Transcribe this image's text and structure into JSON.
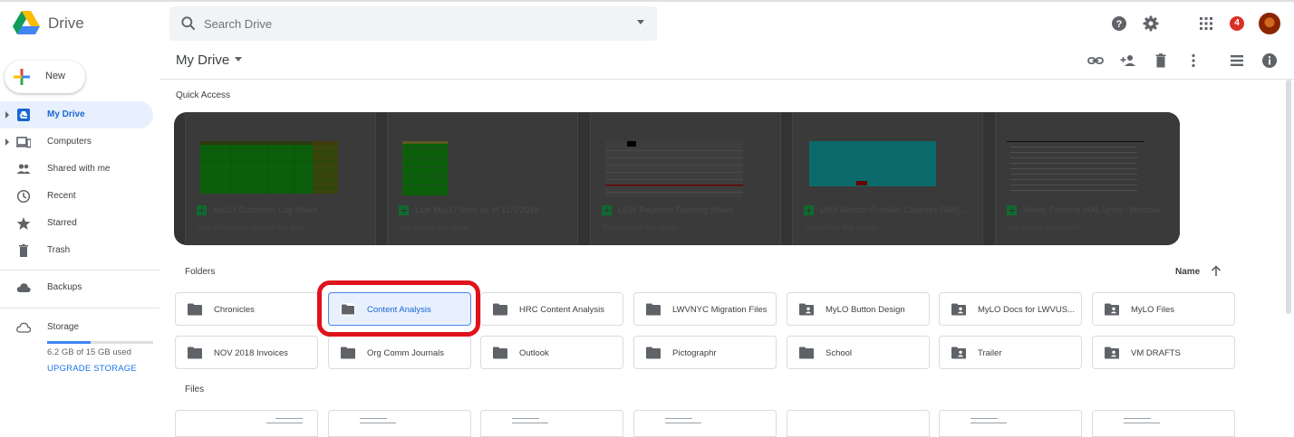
{
  "app": {
    "name": "Drive"
  },
  "search": {
    "placeholder": "Search Drive"
  },
  "header": {
    "notification_count": "4"
  },
  "sidebar": {
    "new_label": "New",
    "items": [
      {
        "label": "My Drive",
        "icon": "my-drive-icon",
        "active": true,
        "expandable": true
      },
      {
        "label": "Computers",
        "icon": "computers-icon",
        "active": false,
        "expandable": true
      },
      {
        "label": "Shared with me",
        "icon": "shared-icon",
        "active": false,
        "expandable": false
      },
      {
        "label": "Recent",
        "icon": "clock-icon",
        "active": false,
        "expandable": false
      },
      {
        "label": "Starred",
        "icon": "star-icon",
        "active": false,
        "expandable": false
      },
      {
        "label": "Trash",
        "icon": "trash-icon",
        "active": false,
        "expandable": false
      }
    ],
    "backups_label": "Backups",
    "storage": {
      "label": "Storage",
      "used_text": "6.2 GB of 15 GB used",
      "used_fraction": 0.413,
      "upgrade_label": "UPGRADE STORAGE"
    }
  },
  "main": {
    "title": "My Drive",
    "quick_access_label": "Quick Access",
    "quick_access": [
      {
        "name": "MyLO Customer Log Sheet",
        "sub": "You often open around this time",
        "thumb": "green"
      },
      {
        "name": "Live MyLO Sites as of 11/5/2018",
        "sub": "You edited this week",
        "thumb": "green-small"
      },
      {
        "name": "LEW Payment Tracking Sheet",
        "sub": "You opened this week",
        "thumb": "grid-red"
      },
      {
        "name": "LWV Benton-Franklin Counties (WA) ...",
        "sub": "You edited this month",
        "thumb": "cyan"
      },
      {
        "name": "Newly Forming MAL Units - Member...",
        "sub": "You edited this month",
        "thumb": "text-grid"
      }
    ],
    "folders_label": "Folders",
    "sort": {
      "label": "Name"
    },
    "folders": [
      {
        "name": "Chronicles",
        "shared": false,
        "selected": false
      },
      {
        "name": "Content Analysis",
        "shared": false,
        "selected": true
      },
      {
        "name": "HRC Content Analysis",
        "shared": false,
        "selected": false
      },
      {
        "name": "LWVNYC Migration Files",
        "shared": false,
        "selected": false
      },
      {
        "name": "MyLO Button Design",
        "shared": true,
        "selected": false
      },
      {
        "name": "MyLO Docs for LWVUS...",
        "shared": true,
        "selected": false
      },
      {
        "name": "MyLO Files",
        "shared": true,
        "selected": false
      },
      {
        "name": "NOV 2018 Invoices",
        "shared": false,
        "selected": false
      },
      {
        "name": "Org Comm Journals",
        "shared": false,
        "selected": false
      },
      {
        "name": "Outlook",
        "shared": false,
        "selected": false
      },
      {
        "name": "Pictographr",
        "shared": false,
        "selected": false
      },
      {
        "name": "School",
        "shared": false,
        "selected": false
      },
      {
        "name": "Trailer",
        "shared": true,
        "selected": false
      },
      {
        "name": "VM DRAFTS",
        "shared": true,
        "selected": false
      }
    ],
    "files_label": "Files",
    "files_count": 7
  },
  "colors": {
    "accent": "#1a73e8",
    "active_bg": "#e8f0fe",
    "highlight": "#e0121c",
    "overlay": "#333333"
  }
}
